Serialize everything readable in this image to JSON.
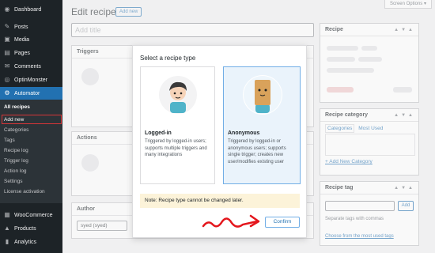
{
  "sidebar": {
    "items": [
      {
        "icon": "dashboard-icon",
        "glyph": "◉",
        "label": "Dashboard"
      },
      {
        "icon": "posts-icon",
        "glyph": "✎",
        "label": "Posts"
      },
      {
        "icon": "media-icon",
        "glyph": "▣",
        "label": "Media"
      },
      {
        "icon": "pages-icon",
        "glyph": "▤",
        "label": "Pages"
      },
      {
        "icon": "comments-icon",
        "glyph": "✉",
        "label": "Comments"
      },
      {
        "icon": "optinmonster-icon",
        "glyph": "◎",
        "label": "OptinMonster"
      },
      {
        "icon": "automator-icon",
        "glyph": "⚙",
        "label": "Automator"
      }
    ],
    "submenu": [
      "All recipes",
      "Add new",
      "Categories",
      "Tags",
      "Recipe log",
      "Trigger log",
      "Action log",
      "Settings",
      "License activation"
    ],
    "lower": [
      {
        "icon": "woocommerce-icon",
        "glyph": "▦",
        "label": "WooCommerce"
      },
      {
        "icon": "products-icon",
        "glyph": "▲",
        "label": "Products"
      },
      {
        "icon": "analytics-icon",
        "glyph": "▮",
        "label": "Analytics"
      }
    ]
  },
  "header": {
    "title": "Edit recipe",
    "add_new": "Add new",
    "screen_options": "Screen Options ▾",
    "title_placeholder": "Add title"
  },
  "boxes": {
    "triggers": "Triggers",
    "actions": "Actions",
    "author": "Author",
    "author_value": "syed (syed)",
    "recipe": "Recipe",
    "category": "Recipe category",
    "cat_tab_all": "Categories",
    "cat_tab_used": "Most Used",
    "add_category": "+ Add New Category",
    "tag": "Recipe tag",
    "tag_add": "Add",
    "tag_help": "Separate tags with commas",
    "tag_choose": "Choose from the most used tags"
  },
  "modal": {
    "title": "Select a recipe type",
    "logged_in_title": "Logged-in",
    "logged_in_desc": "Triggered by logged-in users; supports multiple triggers and many integrations",
    "anon_title": "Anonymous",
    "anon_desc": "Triggered by logged-in or anonymous users; supports single trigger; creates new user/modifies existing user",
    "note": "Note: Recipe type cannot be changed later.",
    "confirm": "Confirm"
  },
  "colors": {
    "admin_bar": "#1d2327",
    "accent": "#2271b1",
    "highlight": "#d63638"
  }
}
